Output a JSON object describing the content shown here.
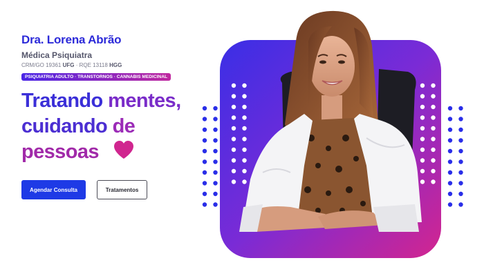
{
  "doctor": {
    "name": "Dra. Lorena Abrão",
    "title": "Médica Psiquiatra",
    "crm_label": "CRM/GO 19361",
    "crm_inst": "UFG",
    "rqe_label": "· RQE 13118",
    "rqe_inst": "HGG"
  },
  "specialties": "PSIQUIATRIA ADULTO · TRANSTORNOS · CANNABIS MEDICINAL",
  "headline": {
    "line1_a": "Tratando",
    "line1_b": "mentes,",
    "line2_a": "cuidando",
    "line2_b": "de",
    "line3": "pessoas"
  },
  "buttons": {
    "primary": "Agendar Consulta",
    "secondary": "Tratamentos"
  },
  "colors": {
    "brand_blue": "#1e3ae6",
    "brand_purple": "#7a2cc9",
    "brand_magenta": "#d02591",
    "dots": "#2a2ee8",
    "heart": "#d0268f"
  },
  "icons": {
    "heart": "heart-icon"
  }
}
